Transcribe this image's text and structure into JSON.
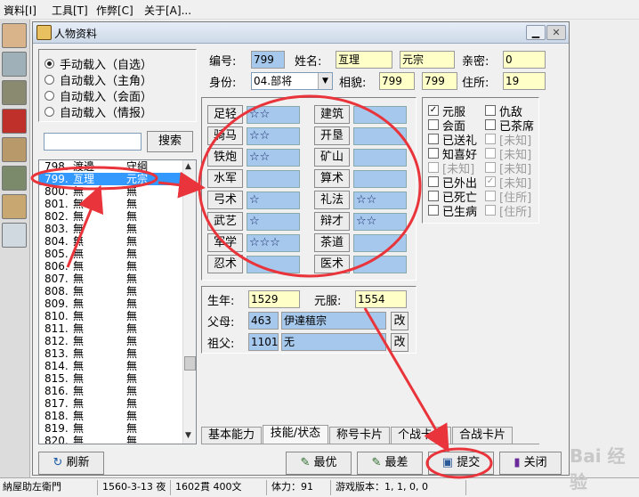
{
  "menu": [
    "資料[I]",
    "工具[T]",
    "作弊[C]",
    "关于[A]..."
  ],
  "window": {
    "title": "人物资料"
  },
  "load_options": [
    {
      "label": "手动载入（自选）",
      "selected": true
    },
    {
      "label": "自动载入（主角）",
      "selected": false
    },
    {
      "label": "自动载入（会面）",
      "selected": false
    },
    {
      "label": "自动载入（情报）",
      "selected": false
    }
  ],
  "search": {
    "value": "",
    "button": "搜索"
  },
  "list": [
    {
      "id": "798.",
      "name": "渡邊",
      "col2": "守綱"
    },
    {
      "id": "799.",
      "name": "亙理",
      "col2": "元宗",
      "selected": true
    },
    {
      "id": "800.",
      "name": "無",
      "col2": "無"
    },
    {
      "id": "801.",
      "name": "無",
      "col2": "無"
    },
    {
      "id": "802.",
      "name": "無",
      "col2": "無"
    },
    {
      "id": "803.",
      "name": "無",
      "col2": "無"
    },
    {
      "id": "804.",
      "name": "無",
      "col2": "無"
    },
    {
      "id": "805.",
      "name": "無",
      "col2": "無"
    },
    {
      "id": "806.",
      "name": "無",
      "col2": "無"
    },
    {
      "id": "807.",
      "name": "無",
      "col2": "無"
    },
    {
      "id": "808.",
      "name": "無",
      "col2": "無"
    },
    {
      "id": "809.",
      "name": "無",
      "col2": "無"
    },
    {
      "id": "810.",
      "name": "無",
      "col2": "無"
    },
    {
      "id": "811.",
      "name": "無",
      "col2": "無"
    },
    {
      "id": "812.",
      "name": "無",
      "col2": "無"
    },
    {
      "id": "813.",
      "name": "無",
      "col2": "無"
    },
    {
      "id": "814.",
      "name": "無",
      "col2": "無"
    },
    {
      "id": "815.",
      "name": "無",
      "col2": "無"
    },
    {
      "id": "816.",
      "name": "無",
      "col2": "無"
    },
    {
      "id": "817.",
      "name": "無",
      "col2": "無"
    },
    {
      "id": "818.",
      "name": "無",
      "col2": "無"
    },
    {
      "id": "819.",
      "name": "無",
      "col2": "無"
    },
    {
      "id": "820.",
      "name": "無",
      "col2": "無"
    }
  ],
  "info": {
    "number_label": "编号:",
    "number": "799",
    "name_label": "姓名:",
    "surname": "亙理",
    "given_name": "元宗",
    "intimacy_label": "亲密:",
    "intimacy": "0",
    "identity_label": "身份:",
    "identity": "04.部将",
    "face_label": "相貌:",
    "face1": "799",
    "face2": "799",
    "residence_label": "住所:",
    "residence": "19"
  },
  "abilities": [
    {
      "label": "足轻",
      "value": "☆☆"
    },
    {
      "label": "骑马",
      "value": "☆☆"
    },
    {
      "label": "铁炮",
      "value": "☆☆"
    },
    {
      "label": "水军",
      "value": ""
    },
    {
      "label": "弓术",
      "value": "☆"
    },
    {
      "label": "武艺",
      "value": "☆"
    },
    {
      "label": "军学",
      "value": "☆☆☆"
    },
    {
      "label": "忍术",
      "value": ""
    },
    {
      "label": "建筑",
      "value": ""
    },
    {
      "label": "开垦",
      "value": ""
    },
    {
      "label": "矿山",
      "value": ""
    },
    {
      "label": "算术",
      "value": ""
    },
    {
      "label": "礼法",
      "value": "☆☆"
    },
    {
      "label": "辩才",
      "value": "☆☆"
    },
    {
      "label": "茶道",
      "value": ""
    },
    {
      "label": "医术",
      "value": ""
    }
  ],
  "status_left": [
    {
      "label": "元服",
      "checked": true,
      "dim": false
    },
    {
      "label": "会面",
      "checked": false,
      "dim": false
    },
    {
      "label": "已送礼",
      "checked": false,
      "dim": false
    },
    {
      "label": "知喜好",
      "checked": false,
      "dim": false
    },
    {
      "label": "[未知]",
      "checked": false,
      "dim": true
    },
    {
      "label": "已外出",
      "checked": false,
      "dim": false
    },
    {
      "label": "已死亡",
      "checked": false,
      "dim": false
    },
    {
      "label": "已生病",
      "checked": false,
      "dim": false
    }
  ],
  "status_right": [
    {
      "label": "仇敌",
      "checked": false,
      "dim": false
    },
    {
      "label": "已茶席",
      "checked": false,
      "dim": false
    },
    {
      "label": "[未知]",
      "checked": false,
      "dim": true
    },
    {
      "label": "[未知]",
      "checked": false,
      "dim": true
    },
    {
      "label": "[未知]",
      "checked": false,
      "dim": true
    },
    {
      "label": "[未知]",
      "checked": true,
      "dim": true
    },
    {
      "label": "[住所]",
      "checked": false,
      "dim": true
    },
    {
      "label": "[住所]",
      "checked": false,
      "dim": true
    }
  ],
  "family": {
    "birth_label": "生年:",
    "birth": "1529",
    "coming_of_age_label": "元服:",
    "coming_of_age": "1554",
    "parent_label": "父母:",
    "parent_id": "463",
    "parent_name": "伊達稙宗",
    "parent_edit": "改",
    "grandparent_label": "祖父:",
    "grandparent_id": "1101",
    "grandparent_name": "无",
    "grandparent_edit": "改"
  },
  "tabs": [
    "基本能力",
    "技能/状态",
    "称号卡片",
    "个战卡片",
    "合战卡片"
  ],
  "active_tab": 1,
  "buttons": {
    "refresh": "刷新",
    "best": "最优",
    "worst": "最差",
    "submit": "提交",
    "close": "关闭"
  },
  "statusbar": [
    "納屋助左衛門",
    "1560-3-13 夜",
    "1602貫 400文",
    "体力：91",
    "游戏版本：1, 1, 0, 0"
  ],
  "watermark": "Bai 经验",
  "colors": {
    "selection": "#3399ff",
    "annotation": "#e8343a",
    "field_yellow": "#ffffc8",
    "field_blue": "#a6c8ec"
  }
}
